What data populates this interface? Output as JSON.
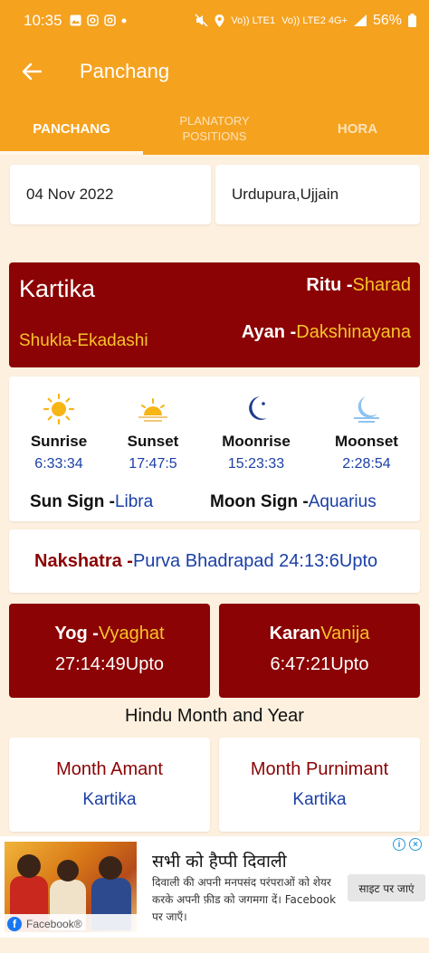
{
  "status_bar": {
    "time": "10:35",
    "battery": "56%",
    "network1": "Vo)) LTE1",
    "network2": "Vo)) LTE2 4G+"
  },
  "app_bar": {
    "title": "Panchang"
  },
  "tabs": [
    {
      "label": "PANCHANG",
      "active": true
    },
    {
      "label": "PLANATORY POSITIONS",
      "active": false
    },
    {
      "label": "HORA",
      "active": false
    }
  ],
  "date": "04 Nov 2022",
  "location": "Urdupura,Ujjain",
  "month_card": {
    "month": "Kartika",
    "tithi": "Shukla-Ekadashi",
    "ritu_label": "Ritu -",
    "ritu_value": "Sharad",
    "ayan_label": "Ayan -",
    "ayan_value": "Dakshinayana"
  },
  "sun_moon": {
    "sunrise_label": "Sunrise",
    "sunrise_time": "6:33:34",
    "sunset_label": "Sunset",
    "sunset_time": "17:47:5",
    "moonrise_label": "Moonrise",
    "moonrise_time": "15:23:33",
    "moonset_label": "Moonset",
    "moonset_time": "2:28:54",
    "sun_sign_label": "Sun Sign -",
    "sun_sign_value": "Libra",
    "moon_sign_label": "Moon Sign -",
    "moon_sign_value": "Aquarius"
  },
  "nakshatra": {
    "label": "Nakshatra -",
    "value": "Purva Bhadrapad 24:13:6Upto"
  },
  "yog": {
    "label": "Yog -",
    "value": "Vyaghat",
    "time": "27:14:49Upto"
  },
  "karan": {
    "label": "Karan",
    "value": "Vanija",
    "time": "6:47:21Upto"
  },
  "hindu_month_year": {
    "heading": "Hindu Month and Year",
    "amant_label": "Month Amant",
    "amant_value": "Kartika",
    "purnimant_label": "Month Purnimant",
    "purnimant_value": "Kartika"
  },
  "ad": {
    "headline": "सभी को हैप्पी दिवाली",
    "body": "दिवाली की अपनी मनपसंद परंपराओं को शेयर करके अपनी फ़ीड को जगमगा दें। Facebook पर जाएँ।",
    "cta": "साइट पर जाएं",
    "source": "Facebook®"
  },
  "colors": {
    "accent": "#f5a21f",
    "maroon": "#8b0304",
    "gold": "#f7c42a",
    "blue": "#1b3fa6",
    "background": "#fdf0df"
  }
}
